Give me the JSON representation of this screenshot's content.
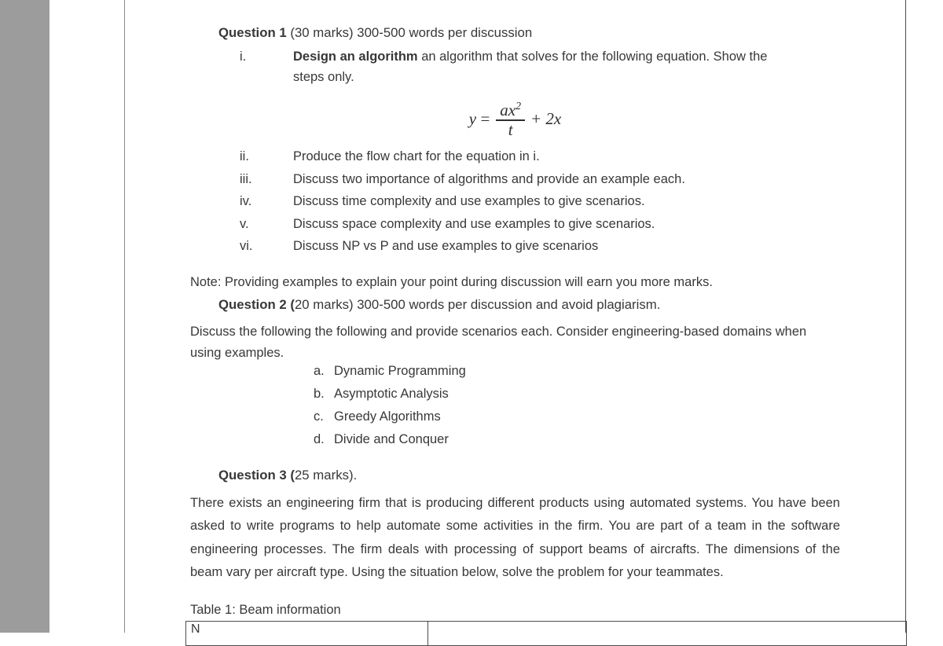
{
  "page": {
    "background_color": "#ffffff",
    "gutter_color": "#9c9c9c",
    "text_color": "#38383a",
    "rule_color": "#4a4a4a"
  },
  "question1": {
    "heading_bold": "Question 1",
    "heading_rest": " (30 marks) 300-500 words per discussion",
    "items": [
      {
        "marker": "i.",
        "bold_lead": "Design an algorithm",
        "text": " an algorithm that solves for the following equation. Show the steps only."
      },
      {
        "marker": "ii.",
        "bold_lead": "",
        "text": "Produce the flow chart for the equation in i."
      },
      {
        "marker": "iii.",
        "bold_lead": "",
        "text": "Discuss two importance of algorithms and provide an example each."
      },
      {
        "marker": "iv.",
        "bold_lead": "",
        "text": "Discuss time complexity and use examples to give scenarios."
      },
      {
        "marker": "v.",
        "bold_lead": "",
        "text": "Discuss space complexity and use examples to give scenarios."
      },
      {
        "marker": "vi.",
        "bold_lead": "",
        "text": "Discuss NP vs P and use examples to give scenarios"
      }
    ],
    "equation": {
      "lhs": "y",
      "equals": "=",
      "numerator_base": "ax",
      "numerator_exponent": "2",
      "denominator": "t",
      "tail": "+  2x",
      "plain": "y = ax^2 / t + 2x"
    }
  },
  "note": "Note: Providing examples to explain your point during discussion will earn you more marks.",
  "question2": {
    "heading_bold": "Question 2 (",
    "heading_rest": "20 marks) 300-500 words per discussion and avoid plagiarism.",
    "intro": "Discuss the following the following and provide scenarios each. Consider engineering-based domains when using examples.",
    "items": [
      {
        "marker": "a.",
        "text": "Dynamic Programming"
      },
      {
        "marker": "b.",
        "text": "Asymptotic Analysis"
      },
      {
        "marker": "c.",
        "text": "Greedy Algorithms"
      },
      {
        "marker": "d.",
        "text": "Divide and Conquer"
      }
    ]
  },
  "question3": {
    "heading_bold": "Question 3 (",
    "heading_rest": "25 marks).",
    "body": "There exists an engineering firm that is producing different products using automated systems. You have been asked to write programs to help automate some activities in the firm. You are part of a team in the software engineering processes. The firm deals with processing of support beams of aircrafts. The dimensions of the beam vary per aircraft type. Using the situation below, solve the problem for your teammates.",
    "table_caption": "Table 1: Beam information",
    "table": {
      "row1_col1": "N",
      "row1_col2": ""
    }
  }
}
